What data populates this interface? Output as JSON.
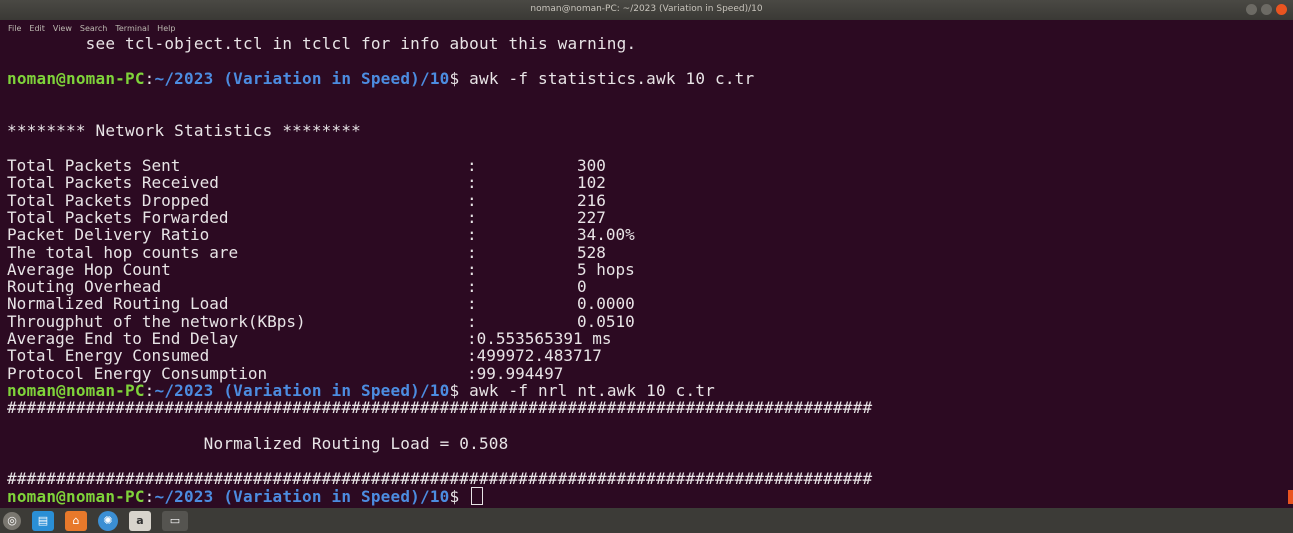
{
  "window": {
    "title": "noman@noman-PC: ~/2023 (Variation in Speed)/10",
    "menu": [
      "File",
      "Edit",
      "View",
      "Search",
      "Terminal",
      "Help"
    ]
  },
  "terminal": {
    "warning_line": "        see tcl-object.tcl in tclcl for info about this warning.",
    "prompt_user": "noman@noman-PC",
    "prompt_sep": ":",
    "prompt_path": "~/2023 (Variation in Speed)/10",
    "cmd1": "$ awk -f statistics.awk 10 c.tr",
    "stats_header": "******** Network Statistics ********",
    "stats": [
      {
        "label": "Total Packets Sent",
        "sep": ":",
        "value": "300"
      },
      {
        "label": "Total Packets Received",
        "sep": ":",
        "value": "102"
      },
      {
        "label": "Total Packets Dropped",
        "sep": ":",
        "value": "216"
      },
      {
        "label": "Total Packets Forwarded",
        "sep": ":",
        "value": "227"
      },
      {
        "label": "Packet Delivery Ratio",
        "sep": ":",
        "value": "34.00%"
      },
      {
        "label": "The total hop counts are",
        "sep": ":",
        "value": "528"
      },
      {
        "label": "Average Hop Count",
        "sep": ":",
        "value": "5 hops"
      },
      {
        "label": "Routing Overhead",
        "sep": ":",
        "value": "0"
      },
      {
        "label": "Normalized Routing Load",
        "sep": ":",
        "value": "0.0000"
      },
      {
        "label": "Througphut of the network(KBps)",
        "sep": ":",
        "value": "0.0510"
      }
    ],
    "stats_tail": [
      {
        "label": "Average End to End Delay",
        "text": ":0.553565391 ms"
      },
      {
        "label": "Total Energy Consumed",
        "text": ":499972.483717"
      },
      {
        "label": "Protocol Energy Consumption",
        "text": ":99.994497"
      }
    ],
    "cmd2": "$ awk -f nrl nt.awk 10 c.tr",
    "hash_line": "########################################################################################",
    "nrl_line": "                    Normalized Routing Load = 0.508",
    "cmd3": "$ "
  },
  "taskbar": {
    "items": [
      {
        "name": "disc-icon",
        "glyph": "◎",
        "color": "#e0dbd2"
      },
      {
        "name": "writer-icon",
        "glyph": "▤",
        "color": "#2a8fd6"
      },
      {
        "name": "home-folder-icon",
        "glyph": "⌂",
        "color": "#e8792b"
      },
      {
        "name": "settings-icon",
        "glyph": "✺",
        "color": "#3b8fd4"
      },
      {
        "name": "software-icon",
        "glyph": "a",
        "color": "#d8d4cc"
      },
      {
        "name": "terminal-icon",
        "glyph": "▭",
        "color": "#555450"
      }
    ]
  }
}
